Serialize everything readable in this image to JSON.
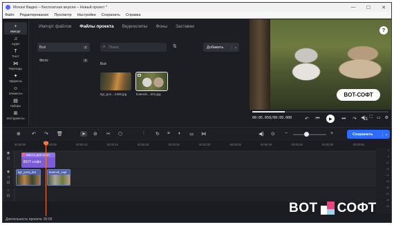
{
  "app": {
    "title": "Movavi Видео – Бесплатная версия – Новый проект *"
  },
  "menu": [
    "Файл",
    "Редактирование",
    "Просмотр",
    "Настройки",
    "Сохранить",
    "Справка"
  ],
  "rail": [
    {
      "label": "Импорт",
      "icon": "plus-icon",
      "glyph": "+"
    },
    {
      "label": "Аудио",
      "icon": "music-note-icon",
      "glyph": "♫"
    },
    {
      "label": "Текст",
      "icon": "text-icon",
      "glyph": "T"
    },
    {
      "label": "Переходы",
      "icon": "transition-icon",
      "glyph": "⋈"
    },
    {
      "label": "Эффекты",
      "icon": "sparkle-icon",
      "glyph": "✦"
    },
    {
      "label": "Элементы",
      "icon": "elements-icon",
      "glyph": "☺"
    },
    {
      "label": "Наборы",
      "icon": "sets-icon",
      "glyph": "▤"
    },
    {
      "label": "Инструменты",
      "icon": "tools-icon",
      "glyph": "⊞"
    }
  ],
  "media": {
    "tabs": [
      "Импорт файлов",
      "Файлы проекта",
      "Видеоклипы",
      "Фоны",
      "Заставки"
    ],
    "folders": [
      {
        "label": "Всё",
        "count": "2"
      },
      {
        "label": "Фото",
        "count": "2"
      }
    ],
    "search_placeholder": "Поиск",
    "add_label": "Добавить",
    "all_label": "Всё",
    "files": [
      {
        "name": "tigr_poz....2400.jpg"
      },
      {
        "name": "kotenok....201.jpg"
      }
    ]
  },
  "preview": {
    "title_text": "BOT-СОФТ",
    "time": "00:05.050/00:09.000",
    "speed": "x1",
    "progress": 0.24
  },
  "toolbar": {
    "save_label": "Сохранить"
  },
  "timeline": {
    "ruler": [
      "00:00:00",
      "00:00:05",
      "00:00:10",
      "00:00:15",
      "00:00:20",
      "00:00:25",
      "00:00:30",
      "00:00:35",
      "00:00:40",
      "00:00:45",
      "00:00:50",
      "00:00:55"
    ],
    "title_clip_header": "Место для текст",
    "title_clip_text": "BOT-софт",
    "video_clips": [
      {
        "label": "tigr_poza_bro"
      },
      {
        "label": "kotenok_vopl"
      }
    ],
    "meter": [
      "0",
      "-6",
      "-12",
      "-18",
      "-24",
      "-30",
      "-36",
      "-42",
      "-48",
      "-54"
    ]
  },
  "status": {
    "duration": "Длительность проекта: 00:09"
  },
  "watermark": {
    "left": "BOT",
    "right": "СОФТ"
  },
  "colors": {
    "accent": "#2e6bff",
    "playhead": "#ff7a2a",
    "title_clip": "#7b5cd6"
  }
}
